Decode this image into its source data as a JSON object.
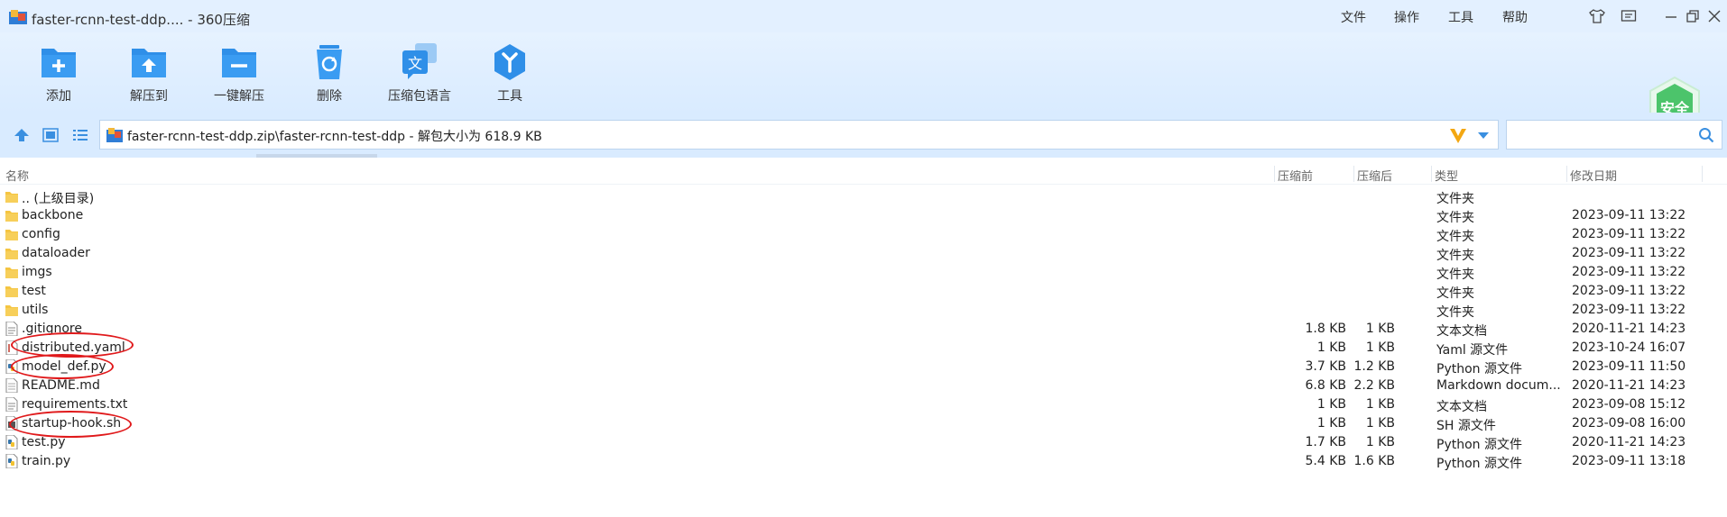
{
  "window": {
    "title": "faster-rcnn-test-ddp.... - 360压缩",
    "menu": [
      "文件",
      "操作",
      "工具",
      "帮助"
    ]
  },
  "toolbar": {
    "add": "添加",
    "extract_to": "解压到",
    "one_click_extract": "一键解压",
    "delete": "删除",
    "archive_language": "压缩包语言",
    "tools": "工具"
  },
  "safety_badge": "安全",
  "address": {
    "path": "faster-rcnn-test-ddp.zip\\faster-rcnn-test-ddp - 解包大小为 618.9 KB",
    "search_placeholder": ""
  },
  "columns": {
    "name": "名称",
    "before": "压缩前",
    "after": "压缩后",
    "type": "类型",
    "modified": "修改日期"
  },
  "files": [
    {
      "name": ".. (上级目录)",
      "before": "",
      "after": "",
      "type": "文件夹",
      "date": "",
      "icon": "folder-icon"
    },
    {
      "name": "backbone",
      "before": "",
      "after": "",
      "type": "文件夹",
      "date": "2023-09-11 13:22",
      "icon": "folder-icon"
    },
    {
      "name": "config",
      "before": "",
      "after": "",
      "type": "文件夹",
      "date": "2023-09-11 13:22",
      "icon": "folder-icon"
    },
    {
      "name": "dataloader",
      "before": "",
      "after": "",
      "type": "文件夹",
      "date": "2023-09-11 13:22",
      "icon": "folder-icon"
    },
    {
      "name": "imgs",
      "before": "",
      "after": "",
      "type": "文件夹",
      "date": "2023-09-11 13:22",
      "icon": "folder-icon"
    },
    {
      "name": "test",
      "before": "",
      "after": "",
      "type": "文件夹",
      "date": "2023-09-11 13:22",
      "icon": "folder-icon"
    },
    {
      "name": "utils",
      "before": "",
      "after": "",
      "type": "文件夹",
      "date": "2023-09-11 13:22",
      "icon": "folder-icon"
    },
    {
      "name": ".gitignore",
      "before": "1.8 KB",
      "after": "1 KB",
      "type": "文本文档",
      "date": "2020-11-21 14:23",
      "icon": "text-file-icon"
    },
    {
      "name": "distributed.yaml",
      "before": "1 KB",
      "after": "1 KB",
      "type": "Yaml 源文件",
      "date": "2023-10-24 16:07",
      "icon": "yaml-file-icon"
    },
    {
      "name": "model_def.py",
      "before": "3.7 KB",
      "after": "1.2 KB",
      "type": "Python 源文件",
      "date": "2023-09-11 11:50",
      "icon": "python-file-icon"
    },
    {
      "name": "README.md",
      "before": "6.8 KB",
      "after": "2.2 KB",
      "type": "Markdown docum...",
      "date": "2020-11-21 14:23",
      "icon": "markdown-file-icon"
    },
    {
      "name": "requirements.txt",
      "before": "1 KB",
      "after": "1 KB",
      "type": "文本文档",
      "date": "2023-09-08 15:12",
      "icon": "text-file-icon"
    },
    {
      "name": "startup-hook.sh",
      "before": "1 KB",
      "after": "1 KB",
      "type": "SH 源文件",
      "date": "2023-09-08 16:00",
      "icon": "shell-file-icon"
    },
    {
      "name": "test.py",
      "before": "1.7 KB",
      "after": "1 KB",
      "type": "Python 源文件",
      "date": "2020-11-21 14:23",
      "icon": "python-file-icon"
    },
    {
      "name": "train.py",
      "before": "5.4 KB",
      "after": "1.6 KB",
      "type": "Python 源文件",
      "date": "2023-09-11 13:18",
      "icon": "python-file-icon"
    }
  ],
  "colors": {
    "accent": "#2f8fe8",
    "folder": "#f5c542",
    "annotation": "#e0191b",
    "safe_green": "#4cc46b"
  }
}
